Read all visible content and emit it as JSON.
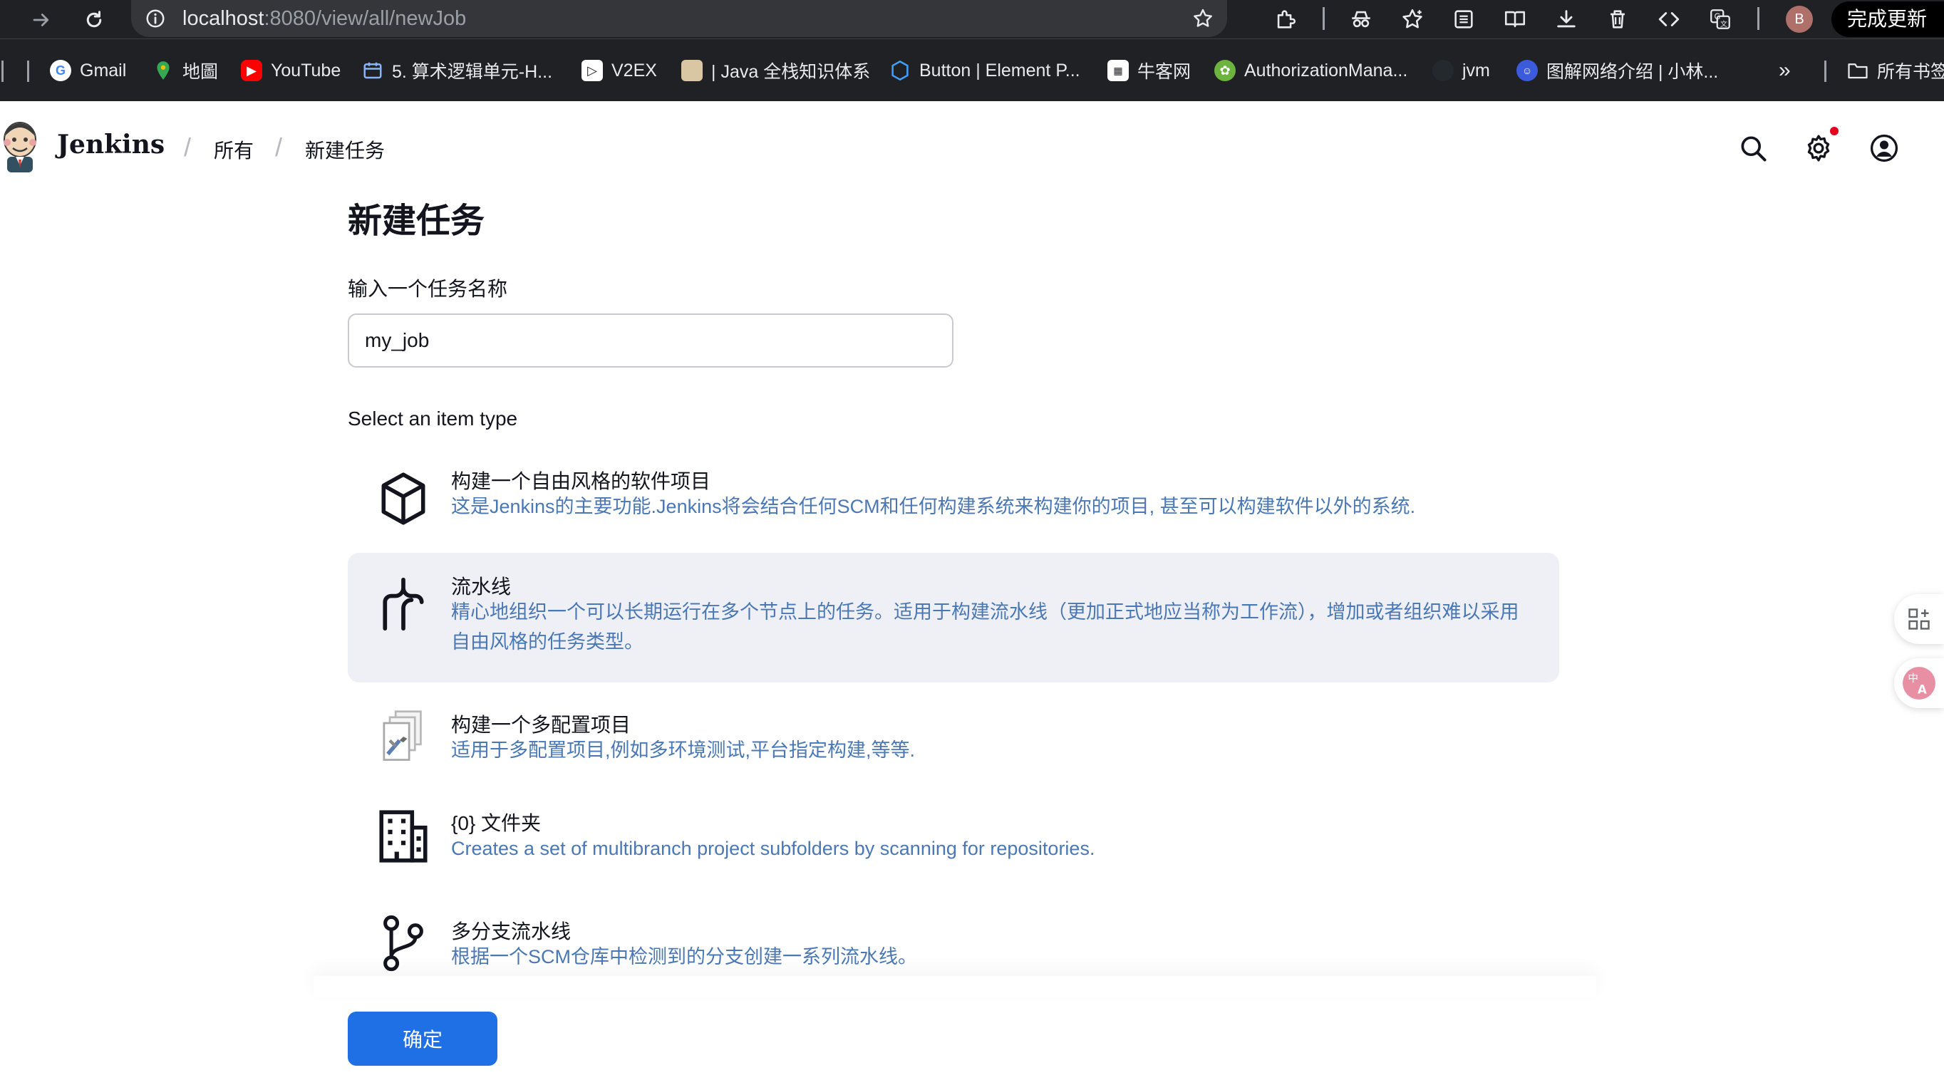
{
  "browser": {
    "url_host": "localhost",
    "url_rest": ":8080/view/all/newJob",
    "avatar_letter": "B",
    "update_label": "完成更新",
    "bookmarks": [
      {
        "label": "Gmail",
        "icon": "google-icon"
      },
      {
        "label": "地圖",
        "icon": "maps-pin-icon"
      },
      {
        "label": "YouTube",
        "icon": "youtube-icon"
      },
      {
        "label": "5. 算术逻辑单元-H...",
        "icon": "calendar-icon"
      },
      {
        "label": "V2EX",
        "icon": "v2ex-icon"
      },
      {
        "label": "| Java 全栈知识体系",
        "icon": "java-site-icon"
      },
      {
        "label": "Button | Element P...",
        "icon": "element-icon"
      },
      {
        "label": "牛客网",
        "icon": "nowcoder-icon"
      },
      {
        "label": "AuthorizationMana...",
        "icon": "spring-icon"
      },
      {
        "label": "jvm",
        "icon": "github-icon"
      },
      {
        "label": "图解网络介绍 | 小林...",
        "icon": "xiaolin-icon"
      }
    ],
    "all_bookmarks_label": "所有书签"
  },
  "header": {
    "app_name": "Jenkins",
    "breadcrumbs": [
      "所有",
      "新建任务"
    ]
  },
  "page": {
    "title": "新建任务",
    "name_label": "输入一个任务名称",
    "name_value": "my_job",
    "type_label": "Select an item type",
    "items": [
      {
        "title": "构建一个自由风格的软件项目",
        "desc": "这是Jenkins的主要功能.Jenkins将会结合任何SCM和任何构建系统来构建你的项目, 甚至可以构建软件以外的系统.",
        "icon": "box-icon"
      },
      {
        "title": "流水线",
        "desc": "精心地组织一个可以长期运行在多个节点上的任务。适用于构建流水线（更加正式地应当称为工作流），增加或者组织难以采用自由风格的任务类型。",
        "icon": "pipeline-icon",
        "selected": true
      },
      {
        "title": "构建一个多配置项目",
        "desc": "适用于多配置项目,例如多环境测试,平台指定构建,等等.",
        "icon": "multi-config-icon"
      },
      {
        "title": "{0} 文件夹",
        "desc": "Creates a set of multibranch project subfolders by scanning for repositories.",
        "icon": "building-icon"
      },
      {
        "title": "多分支流水线",
        "desc": "根据一个SCM仓库中检测到的分支创建一系列流水线。",
        "icon": "branch-icon"
      }
    ],
    "ok_label": "确定"
  },
  "colors": {
    "accent": "#1f6fe5",
    "description": "#4a78b5",
    "selected_bg": "#eef0f5",
    "chrome_bg": "#202124"
  }
}
